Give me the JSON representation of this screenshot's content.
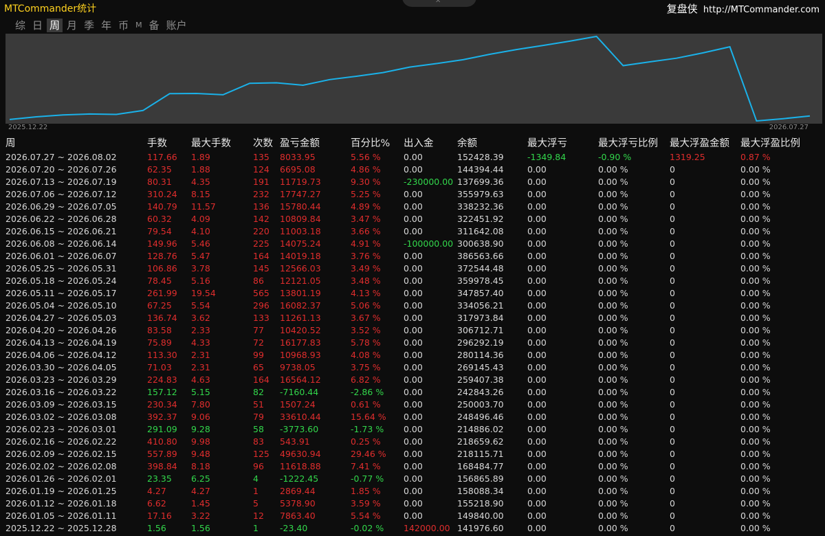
{
  "app_title": "MTCommander统计",
  "brand": {
    "name": "复盘侠",
    "url": "http://MTCommander.com"
  },
  "tabs": [
    {
      "label": "综",
      "active": false,
      "small": false
    },
    {
      "label": "日",
      "active": false,
      "small": false
    },
    {
      "label": "周",
      "active": true,
      "small": false
    },
    {
      "label": "月",
      "active": false,
      "small": false
    },
    {
      "label": "季",
      "active": false,
      "small": false
    },
    {
      "label": "年",
      "active": false,
      "small": false
    },
    {
      "label": "币",
      "active": false,
      "small": false
    },
    {
      "label": "M",
      "active": false,
      "small": true
    },
    {
      "label": "备",
      "active": false,
      "small": false
    },
    {
      "label": "账户",
      "active": false,
      "small": false
    }
  ],
  "colors": {
    "line": "#1ab2ea",
    "chart_bg": "#3a3a3a",
    "profit": "#e02d2d",
    "loss": "#32d74b",
    "title": "#ffd21f"
  },
  "chart_data": {
    "type": "line",
    "x_start_label": "2025.12.22",
    "x_end_label": "2026.07.27",
    "y_label": "余额",
    "x": [
      "2025.12.22",
      "2026.01.05",
      "2026.01.12",
      "2026.01.19",
      "2026.01.26",
      "2026.02.02",
      "2026.02.09",
      "2026.02.16",
      "2026.02.23",
      "2026.03.02",
      "2026.03.09",
      "2026.03.16",
      "2026.03.23",
      "2026.03.30",
      "2026.04.06",
      "2026.04.13",
      "2026.04.20",
      "2026.04.27",
      "2026.05.04",
      "2026.05.11",
      "2026.05.18",
      "2026.05.25",
      "2026.06.01",
      "2026.06.08",
      "2026.06.15",
      "2026.06.22",
      "2026.06.29",
      "2026.07.06",
      "2026.07.13",
      "2026.07.20",
      "2026.07.27"
    ],
    "values": [
      141976.6,
      149840.0,
      155218.9,
      158088.34,
      156865.89,
      168484.77,
      218115.71,
      218659.62,
      214886.02,
      248496.46,
      250003.7,
      242843.26,
      259407.38,
      269145.43,
      280114.36,
      296292.19,
      306712.71,
      317973.84,
      334056.21,
      347857.4,
      359978.45,
      372544.48,
      386563.66,
      300638.9,
      311642.08,
      322451.92,
      338232.36,
      355979.63,
      137699.36,
      144394.44,
      152428.39
    ]
  },
  "table": {
    "headers": [
      "周",
      "手数",
      "最大手数",
      "次数",
      "盈亏金额",
      "百分比%",
      "出入金",
      "余额",
      "最大浮亏",
      "最大浮亏比例",
      "最大浮盈金额",
      "最大浮盈比例"
    ],
    "rows": [
      {
        "c": [
          "2026.07.27 ~ 2026.08.02",
          "117.66",
          "1.89",
          "135",
          "8033.95",
          "5.56 %",
          "0.00",
          "152428.39",
          "-1349.84",
          "-0.90 %",
          "1319.25",
          "0.87 %"
        ],
        "s": [
          "neu",
          "pos",
          "pos",
          "pos",
          "pos",
          "pos",
          "neu",
          "neu",
          "neg",
          "neg",
          "pos",
          "pos"
        ]
      },
      {
        "c": [
          "2026.07.20 ~ 2026.07.26",
          "62.35",
          "1.88",
          "124",
          "6695.08",
          "4.86 %",
          "0.00",
          "144394.44",
          "0.00",
          "0.00 %",
          "0",
          "0.00 %"
        ],
        "s": [
          "neu",
          "pos",
          "pos",
          "pos",
          "pos",
          "pos",
          "neu",
          "neu",
          "neu",
          "neu",
          "neu",
          "neu"
        ]
      },
      {
        "c": [
          "2026.07.13 ~ 2026.07.19",
          "80.31",
          "4.35",
          "191",
          "11719.73",
          "9.30 %",
          "-230000.00",
          "137699.36",
          "0.00",
          "0.00 %",
          "0",
          "0.00 %"
        ],
        "s": [
          "neu",
          "pos",
          "pos",
          "pos",
          "pos",
          "pos",
          "neg",
          "neu",
          "neu",
          "neu",
          "neu",
          "neu"
        ]
      },
      {
        "c": [
          "2026.07.06 ~ 2026.07.12",
          "310.24",
          "8.15",
          "232",
          "17747.27",
          "5.25 %",
          "0.00",
          "355979.63",
          "0.00",
          "0.00 %",
          "0",
          "0.00 %"
        ],
        "s": [
          "neu",
          "pos",
          "pos",
          "pos",
          "pos",
          "pos",
          "neu",
          "neu",
          "neu",
          "neu",
          "neu",
          "neu"
        ]
      },
      {
        "c": [
          "2026.06.29 ~ 2026.07.05",
          "140.79",
          "11.57",
          "136",
          "15780.44",
          "4.89 %",
          "0.00",
          "338232.36",
          "0.00",
          "0.00 %",
          "0",
          "0.00 %"
        ],
        "s": [
          "neu",
          "pos",
          "pos",
          "pos",
          "pos",
          "pos",
          "neu",
          "neu",
          "neu",
          "neu",
          "neu",
          "neu"
        ]
      },
      {
        "c": [
          "2026.06.22 ~ 2026.06.28",
          "60.32",
          "4.09",
          "142",
          "10809.84",
          "3.47 %",
          "0.00",
          "322451.92",
          "0.00",
          "0.00 %",
          "0",
          "0.00 %"
        ],
        "s": [
          "neu",
          "pos",
          "pos",
          "pos",
          "pos",
          "pos",
          "neu",
          "neu",
          "neu",
          "neu",
          "neu",
          "neu"
        ]
      },
      {
        "c": [
          "2026.06.15 ~ 2026.06.21",
          "79.54",
          "4.10",
          "220",
          "11003.18",
          "3.66 %",
          "0.00",
          "311642.08",
          "0.00",
          "0.00 %",
          "0",
          "0.00 %"
        ],
        "s": [
          "neu",
          "pos",
          "pos",
          "pos",
          "pos",
          "pos",
          "neu",
          "neu",
          "neu",
          "neu",
          "neu",
          "neu"
        ]
      },
      {
        "c": [
          "2026.06.08 ~ 2026.06.14",
          "149.96",
          "5.46",
          "225",
          "14075.24",
          "4.91 %",
          "-100000.00",
          "300638.90",
          "0.00",
          "0.00 %",
          "0",
          "0.00 %"
        ],
        "s": [
          "neu",
          "pos",
          "pos",
          "pos",
          "pos",
          "pos",
          "neg",
          "neu",
          "neu",
          "neu",
          "neu",
          "neu"
        ]
      },
      {
        "c": [
          "2026.06.01 ~ 2026.06.07",
          "128.76",
          "5.47",
          "164",
          "14019.18",
          "3.76 %",
          "0.00",
          "386563.66",
          "0.00",
          "0.00 %",
          "0",
          "0.00 %"
        ],
        "s": [
          "neu",
          "pos",
          "pos",
          "pos",
          "pos",
          "pos",
          "neu",
          "neu",
          "neu",
          "neu",
          "neu",
          "neu"
        ]
      },
      {
        "c": [
          "2026.05.25 ~ 2026.05.31",
          "106.86",
          "3.78",
          "145",
          "12566.03",
          "3.49 %",
          "0.00",
          "372544.48",
          "0.00",
          "0.00 %",
          "0",
          "0.00 %"
        ],
        "s": [
          "neu",
          "pos",
          "pos",
          "pos",
          "pos",
          "pos",
          "neu",
          "neu",
          "neu",
          "neu",
          "neu",
          "neu"
        ]
      },
      {
        "c": [
          "2026.05.18 ~ 2026.05.24",
          "78.45",
          "5.16",
          "86",
          "12121.05",
          "3.48 %",
          "0.00",
          "359978.45",
          "0.00",
          "0.00 %",
          "0",
          "0.00 %"
        ],
        "s": [
          "neu",
          "pos",
          "pos",
          "pos",
          "pos",
          "pos",
          "neu",
          "neu",
          "neu",
          "neu",
          "neu",
          "neu"
        ]
      },
      {
        "c": [
          "2026.05.11 ~ 2026.05.17",
          "261.99",
          "19.54",
          "565",
          "13801.19",
          "4.13 %",
          "0.00",
          "347857.40",
          "0.00",
          "0.00 %",
          "0",
          "0.00 %"
        ],
        "s": [
          "neu",
          "pos",
          "pos",
          "pos",
          "pos",
          "pos",
          "neu",
          "neu",
          "neu",
          "neu",
          "neu",
          "neu"
        ]
      },
      {
        "c": [
          "2026.05.04 ~ 2026.05.10",
          "67.25",
          "5.54",
          "296",
          "16082.37",
          "5.06 %",
          "0.00",
          "334056.21",
          "0.00",
          "0.00 %",
          "0",
          "0.00 %"
        ],
        "s": [
          "neu",
          "pos",
          "pos",
          "pos",
          "pos",
          "pos",
          "neu",
          "neu",
          "neu",
          "neu",
          "neu",
          "neu"
        ]
      },
      {
        "c": [
          "2026.04.27 ~ 2026.05.03",
          "136.74",
          "3.62",
          "133",
          "11261.13",
          "3.67 %",
          "0.00",
          "317973.84",
          "0.00",
          "0.00 %",
          "0",
          "0.00 %"
        ],
        "s": [
          "neu",
          "pos",
          "pos",
          "pos",
          "pos",
          "pos",
          "neu",
          "neu",
          "neu",
          "neu",
          "neu",
          "neu"
        ]
      },
      {
        "c": [
          "2026.04.20 ~ 2026.04.26",
          "83.58",
          "2.33",
          "77",
          "10420.52",
          "3.52 %",
          "0.00",
          "306712.71",
          "0.00",
          "0.00 %",
          "0",
          "0.00 %"
        ],
        "s": [
          "neu",
          "pos",
          "pos",
          "pos",
          "pos",
          "pos",
          "neu",
          "neu",
          "neu",
          "neu",
          "neu",
          "neu"
        ]
      },
      {
        "c": [
          "2026.04.13 ~ 2026.04.19",
          "75.89",
          "4.33",
          "72",
          "16177.83",
          "5.78 %",
          "0.00",
          "296292.19",
          "0.00",
          "0.00 %",
          "0",
          "0.00 %"
        ],
        "s": [
          "neu",
          "pos",
          "pos",
          "pos",
          "pos",
          "pos",
          "neu",
          "neu",
          "neu",
          "neu",
          "neu",
          "neu"
        ]
      },
      {
        "c": [
          "2026.04.06 ~ 2026.04.12",
          "113.30",
          "2.31",
          "99",
          "10968.93",
          "4.08 %",
          "0.00",
          "280114.36",
          "0.00",
          "0.00 %",
          "0",
          "0.00 %"
        ],
        "s": [
          "neu",
          "pos",
          "pos",
          "pos",
          "pos",
          "pos",
          "neu",
          "neu",
          "neu",
          "neu",
          "neu",
          "neu"
        ]
      },
      {
        "c": [
          "2026.03.30 ~ 2026.04.05",
          "71.03",
          "2.31",
          "65",
          "9738.05",
          "3.75 %",
          "0.00",
          "269145.43",
          "0.00",
          "0.00 %",
          "0",
          "0.00 %"
        ],
        "s": [
          "neu",
          "pos",
          "pos",
          "pos",
          "pos",
          "pos",
          "neu",
          "neu",
          "neu",
          "neu",
          "neu",
          "neu"
        ]
      },
      {
        "c": [
          "2026.03.23 ~ 2026.03.29",
          "224.83",
          "4.63",
          "164",
          "16564.12",
          "6.82 %",
          "0.00",
          "259407.38",
          "0.00",
          "0.00 %",
          "0",
          "0.00 %"
        ],
        "s": [
          "neu",
          "pos",
          "pos",
          "pos",
          "pos",
          "pos",
          "neu",
          "neu",
          "neu",
          "neu",
          "neu",
          "neu"
        ]
      },
      {
        "c": [
          "2026.03.16 ~ 2026.03.22",
          "157.12",
          "5.15",
          "82",
          "-7160.44",
          "-2.86 %",
          "0.00",
          "242843.26",
          "0.00",
          "0.00 %",
          "0",
          "0.00 %"
        ],
        "s": [
          "neu",
          "neg",
          "neg",
          "neg",
          "neg",
          "neg",
          "neu",
          "neu",
          "neu",
          "neu",
          "neu",
          "neu"
        ]
      },
      {
        "c": [
          "2026.03.09 ~ 2026.03.15",
          "230.34",
          "7.80",
          "51",
          "1507.24",
          "0.61 %",
          "0.00",
          "250003.70",
          "0.00",
          "0.00 %",
          "0",
          "0.00 %"
        ],
        "s": [
          "neu",
          "pos",
          "pos",
          "pos",
          "pos",
          "pos",
          "neu",
          "neu",
          "neu",
          "neu",
          "neu",
          "neu"
        ]
      },
      {
        "c": [
          "2026.03.02 ~ 2026.03.08",
          "392.37",
          "9.06",
          "79",
          "33610.44",
          "15.64 %",
          "0.00",
          "248496.46",
          "0.00",
          "0.00 %",
          "0",
          "0.00 %"
        ],
        "s": [
          "neu",
          "pos",
          "pos",
          "pos",
          "pos",
          "pos",
          "neu",
          "neu",
          "neu",
          "neu",
          "neu",
          "neu"
        ]
      },
      {
        "c": [
          "2026.02.23 ~ 2026.03.01",
          "291.09",
          "9.28",
          "58",
          "-3773.60",
          "-1.73 %",
          "0.00",
          "214886.02",
          "0.00",
          "0.00 %",
          "0",
          "0.00 %"
        ],
        "s": [
          "neu",
          "neg",
          "neg",
          "neg",
          "neg",
          "neg",
          "neu",
          "neu",
          "neu",
          "neu",
          "neu",
          "neu"
        ]
      },
      {
        "c": [
          "2026.02.16 ~ 2026.02.22",
          "410.80",
          "9.98",
          "83",
          "543.91",
          "0.25 %",
          "0.00",
          "218659.62",
          "0.00",
          "0.00 %",
          "0",
          "0.00 %"
        ],
        "s": [
          "neu",
          "pos",
          "pos",
          "pos",
          "pos",
          "pos",
          "neu",
          "neu",
          "neu",
          "neu",
          "neu",
          "neu"
        ]
      },
      {
        "c": [
          "2026.02.09 ~ 2026.02.15",
          "557.89",
          "9.48",
          "125",
          "49630.94",
          "29.46 %",
          "0.00",
          "218115.71",
          "0.00",
          "0.00 %",
          "0",
          "0.00 %"
        ],
        "s": [
          "neu",
          "pos",
          "pos",
          "pos",
          "pos",
          "pos",
          "neu",
          "neu",
          "neu",
          "neu",
          "neu",
          "neu"
        ]
      },
      {
        "c": [
          "2026.02.02 ~ 2026.02.08",
          "398.84",
          "8.18",
          "96",
          "11618.88",
          "7.41 %",
          "0.00",
          "168484.77",
          "0.00",
          "0.00 %",
          "0",
          "0.00 %"
        ],
        "s": [
          "neu",
          "pos",
          "pos",
          "pos",
          "pos",
          "pos",
          "neu",
          "neu",
          "neu",
          "neu",
          "neu",
          "neu"
        ]
      },
      {
        "c": [
          "2026.01.26 ~ 2026.02.01",
          "23.35",
          "6.25",
          "4",
          "-1222.45",
          "-0.77 %",
          "0.00",
          "156865.89",
          "0.00",
          "0.00 %",
          "0",
          "0.00 %"
        ],
        "s": [
          "neu",
          "neg",
          "neg",
          "neg",
          "neg",
          "neg",
          "neu",
          "neu",
          "neu",
          "neu",
          "neu",
          "neu"
        ]
      },
      {
        "c": [
          "2026.01.19 ~ 2026.01.25",
          "4.27",
          "4.27",
          "1",
          "2869.44",
          "1.85 %",
          "0.00",
          "158088.34",
          "0.00",
          "0.00 %",
          "0",
          "0.00 %"
        ],
        "s": [
          "neu",
          "pos",
          "pos",
          "pos",
          "pos",
          "pos",
          "neu",
          "neu",
          "neu",
          "neu",
          "neu",
          "neu"
        ]
      },
      {
        "c": [
          "2026.01.12 ~ 2026.01.18",
          "6.62",
          "1.45",
          "5",
          "5378.90",
          "3.59 %",
          "0.00",
          "155218.90",
          "0.00",
          "0.00 %",
          "0",
          "0.00 %"
        ],
        "s": [
          "neu",
          "pos",
          "pos",
          "pos",
          "pos",
          "pos",
          "neu",
          "neu",
          "neu",
          "neu",
          "neu",
          "neu"
        ]
      },
      {
        "c": [
          "2026.01.05 ~ 2026.01.11",
          "17.16",
          "3.22",
          "12",
          "7863.40",
          "5.54 %",
          "0.00",
          "149840.00",
          "0.00",
          "0.00 %",
          "0",
          "0.00 %"
        ],
        "s": [
          "neu",
          "pos",
          "pos",
          "pos",
          "pos",
          "pos",
          "neu",
          "neu",
          "neu",
          "neu",
          "neu",
          "neu"
        ]
      },
      {
        "c": [
          "2025.12.22 ~ 2025.12.28",
          "1.56",
          "1.56",
          "1",
          "-23.40",
          "-0.02 %",
          "142000.00",
          "141976.60",
          "0.00",
          "0.00 %",
          "0",
          "0.00 %"
        ],
        "s": [
          "neu",
          "neg",
          "neg",
          "neg",
          "neg",
          "neg",
          "pos",
          "neu",
          "neu",
          "neu",
          "neu",
          "neu"
        ]
      }
    ]
  }
}
